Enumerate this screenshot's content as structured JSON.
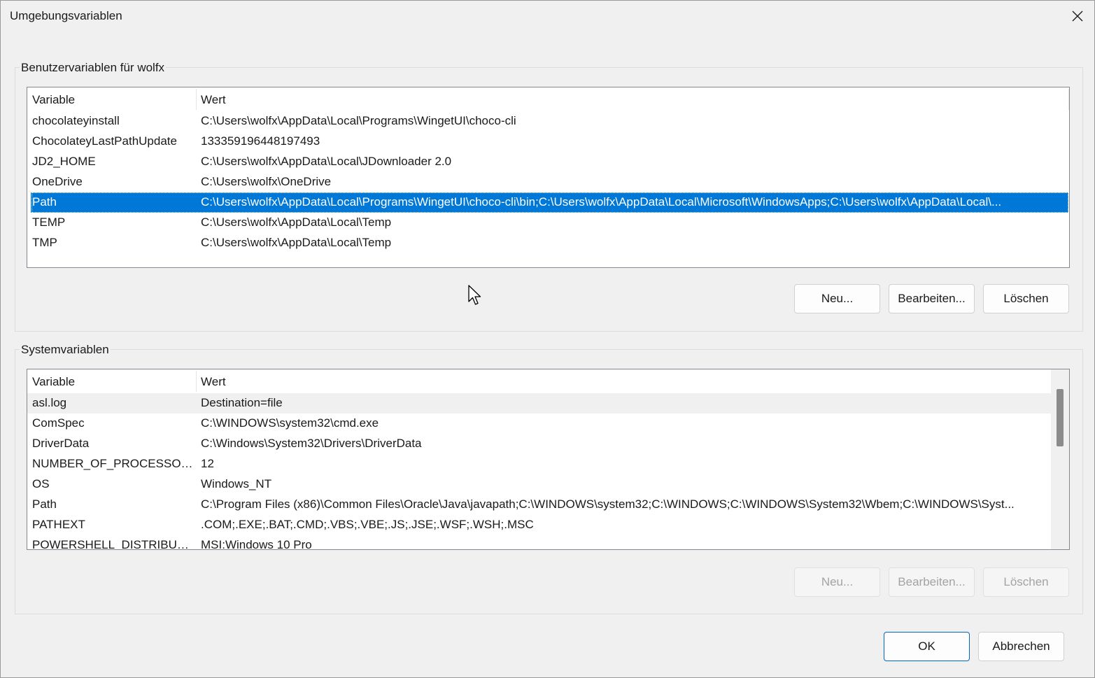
{
  "window": {
    "title": "Umgebungsvariablen"
  },
  "icons": {
    "close": "close-icon",
    "cursor": "mouse-pointer-icon"
  },
  "colors": {
    "selection": "#0078d7",
    "accent_border": "#0067c0"
  },
  "user_group": {
    "label": "Benutzervariablen für wolfx",
    "columns": {
      "variable": "Variable",
      "value": "Wert"
    },
    "selected_index": 4,
    "rows": [
      {
        "name": "chocolateyinstall",
        "value": "C:\\Users\\wolfx\\AppData\\Local\\Programs\\WingetUI\\choco-cli"
      },
      {
        "name": "ChocolateyLastPathUpdate",
        "value": "133359196448197493"
      },
      {
        "name": "JD2_HOME",
        "value": "C:\\Users\\wolfx\\AppData\\Local\\JDownloader 2.0"
      },
      {
        "name": "OneDrive",
        "value": "C:\\Users\\wolfx\\OneDrive"
      },
      {
        "name": "Path",
        "value": "C:\\Users\\wolfx\\AppData\\Local\\Programs\\WingetUI\\choco-cli\\bin;C:\\Users\\wolfx\\AppData\\Local\\Microsoft\\WindowsApps;C:\\Users\\wolfx\\AppData\\Local\\..."
      },
      {
        "name": "TEMP",
        "value": "C:\\Users\\wolfx\\AppData\\Local\\Temp"
      },
      {
        "name": "TMP",
        "value": "C:\\Users\\wolfx\\AppData\\Local\\Temp"
      }
    ],
    "buttons": {
      "new": "Neu...",
      "edit": "Bearbeiten...",
      "delete": "Löschen"
    }
  },
  "system_group": {
    "label": "Systemvariablen",
    "columns": {
      "variable": "Variable",
      "value": "Wert"
    },
    "hover_index": 0,
    "rows": [
      {
        "name": "asl.log",
        "value": "Destination=file"
      },
      {
        "name": "ComSpec",
        "value": "C:\\WINDOWS\\system32\\cmd.exe"
      },
      {
        "name": "DriverData",
        "value": "C:\\Windows\\System32\\Drivers\\DriverData"
      },
      {
        "name": "NUMBER_OF_PROCESSORS",
        "value": "12"
      },
      {
        "name": "OS",
        "value": "Windows_NT"
      },
      {
        "name": "Path",
        "value": "C:\\Program Files (x86)\\Common Files\\Oracle\\Java\\javapath;C:\\WINDOWS\\system32;C:\\WINDOWS;C:\\WINDOWS\\System32\\Wbem;C:\\WINDOWS\\Syst..."
      },
      {
        "name": "PATHEXT",
        "value": ".COM;.EXE;.BAT;.CMD;.VBS;.VBE;.JS;.JSE;.WSF;.WSH;.MSC"
      },
      {
        "name": "POWERSHELL_DISTRIBUTIO...",
        "value": "MSI:Windows 10 Pro"
      }
    ],
    "buttons": {
      "new": "Neu...",
      "edit": "Bearbeiten...",
      "delete": "Löschen"
    }
  },
  "footer": {
    "ok": "OK",
    "cancel": "Abbrechen"
  }
}
